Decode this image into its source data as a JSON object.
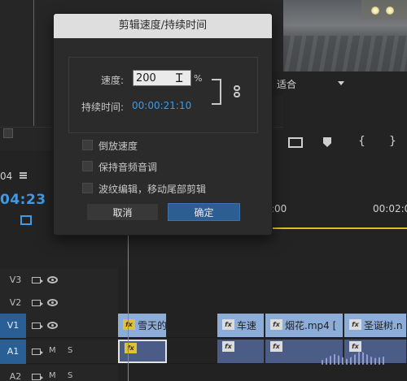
{
  "dialog": {
    "title": "剪辑速度/持续时间",
    "speed_label": "速度:",
    "speed_value": "200",
    "speed_unit": "%",
    "duration_label": "持续时间:",
    "duration_value": "00:00:21:10",
    "options": [
      {
        "label": "倒放速度",
        "checked": false
      },
      {
        "label": "保持音频音调",
        "checked": false
      },
      {
        "label": "波纹编辑，移动尾部剪辑",
        "checked": false
      }
    ],
    "cancel_label": "取消",
    "ok_label": "确定"
  },
  "program_monitor": {
    "fit_value": "适合"
  },
  "timeline": {
    "sequence_label": "04",
    "timecode": "04:23",
    "ruler_labels": [
      ":00",
      "00:02:0"
    ],
    "tracks": [
      {
        "name": "V3",
        "type": "video"
      },
      {
        "name": "V2",
        "type": "video"
      },
      {
        "name": "V1",
        "type": "video",
        "active": true
      },
      {
        "name": "A1",
        "type": "audio",
        "active": true
      },
      {
        "name": "A2",
        "type": "audio"
      }
    ],
    "audio_controls": {
      "mute": "M",
      "solo": "S"
    },
    "clips": [
      {
        "track": "V1",
        "label": "雪天的",
        "badge": "fx"
      },
      {
        "track": "V1",
        "label": "车速",
        "badge": "fx"
      },
      {
        "track": "V1",
        "label": "烟花.mp4 [",
        "badge": "fx"
      },
      {
        "track": "V1",
        "label": "圣诞树.n",
        "badge": "fx"
      }
    ]
  },
  "colors": {
    "accent": "#3d9be9",
    "clip_video": "#8dadd9",
    "clip_audio": "#4b5c86",
    "ok_button": "#2c5e92",
    "ruler_yellow": "#d7c322"
  }
}
